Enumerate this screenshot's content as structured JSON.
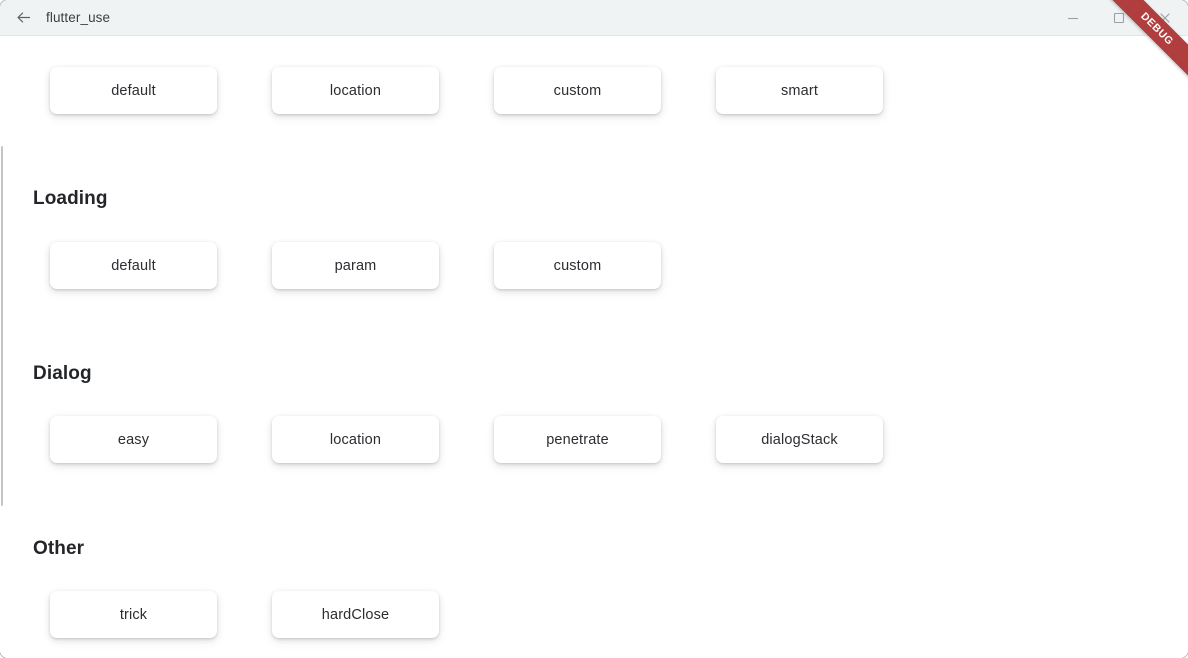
{
  "window": {
    "title": "flutter_use",
    "back_icon": "arrow-left-icon",
    "controls": [
      {
        "name": "minimize",
        "icon": "minimize-icon"
      },
      {
        "name": "maximize",
        "icon": "maximize-icon"
      },
      {
        "name": "close",
        "icon": "close-icon"
      }
    ]
  },
  "overlay": {
    "debug_banner": "DEBUG",
    "debug_color": "#b13e3e"
  },
  "theme": {
    "titlebar_bg": "#f0f3f4",
    "page_bg": "#ffffff",
    "button_bg": "#ffffff",
    "heading_color": "#232529",
    "button_text_color": "#2b2d31"
  },
  "sections": [
    {
      "id": "toast",
      "heading": "",
      "heading_visible": false,
      "buttons": [
        {
          "label": "default"
        },
        {
          "label": "location"
        },
        {
          "label": "custom"
        },
        {
          "label": "smart"
        }
      ]
    },
    {
      "id": "loading",
      "heading": "Loading",
      "heading_visible": true,
      "buttons": [
        {
          "label": "default"
        },
        {
          "label": "param"
        },
        {
          "label": "custom"
        }
      ]
    },
    {
      "id": "dialog",
      "heading": "Dialog",
      "heading_visible": true,
      "buttons": [
        {
          "label": "easy"
        },
        {
          "label": "location"
        },
        {
          "label": "penetrate"
        },
        {
          "label": "dialogStack"
        }
      ]
    },
    {
      "id": "other",
      "heading": "Other",
      "heading_visible": true,
      "buttons": [
        {
          "label": "trick"
        },
        {
          "label": "hardClose"
        }
      ]
    }
  ]
}
